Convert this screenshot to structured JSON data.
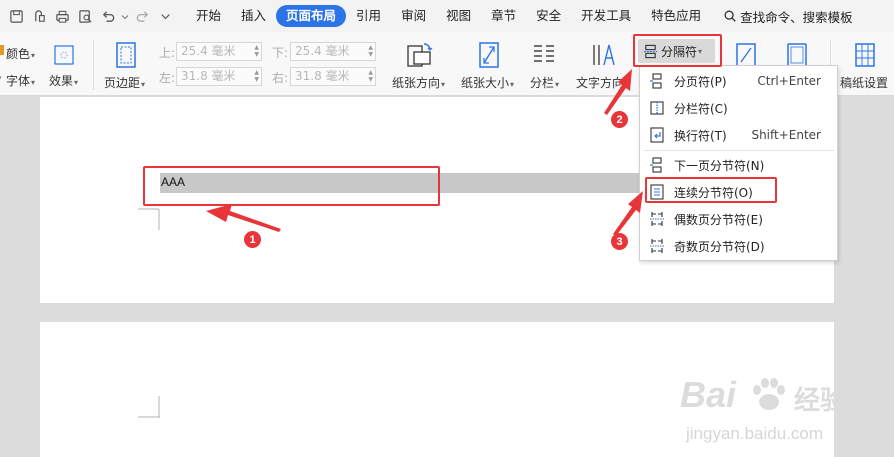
{
  "menu": {
    "tabs": [
      {
        "label": "开始",
        "active": false
      },
      {
        "label": "插入",
        "active": false
      },
      {
        "label": "页面布局",
        "active": true
      },
      {
        "label": "引用",
        "active": false
      },
      {
        "label": "审阅",
        "active": false
      },
      {
        "label": "视图",
        "active": false
      },
      {
        "label": "章节",
        "active": false
      },
      {
        "label": "安全",
        "active": false
      },
      {
        "label": "开发工具",
        "active": false
      },
      {
        "label": "特色应用",
        "active": false
      }
    ],
    "search_label": "查找命令、搜索模板"
  },
  "ribbon": {
    "color_label": "颜色",
    "font_label": "字体",
    "effect_label": "效果",
    "margin_label": "页边距",
    "top_label": "上:",
    "top_value": "25.4 毫米",
    "bottom_label": "下:",
    "bottom_value": "25.4 毫米",
    "left_label": "左:",
    "left_value": "31.8 毫米",
    "right_label": "右:",
    "right_value": "31.8 毫米",
    "orientation_label": "纸张方向",
    "size_label": "纸张大小",
    "columns_label": "分栏",
    "text_dir_label": "文字方向",
    "separator_label": "分隔符",
    "draft_label": "稿纸设置"
  },
  "document": {
    "text": "AAA"
  },
  "dropdown": {
    "items": [
      {
        "label": "分页符(P)",
        "shortcut": "Ctrl+Enter"
      },
      {
        "label": "分栏符(C)",
        "shortcut": ""
      },
      {
        "label": "换行符(T)",
        "shortcut": "Shift+Enter"
      },
      {
        "label": "下一页分节符(N)",
        "shortcut": ""
      },
      {
        "label": "连续分节符(O)",
        "shortcut": ""
      },
      {
        "label": "偶数页分节符(E)",
        "shortcut": ""
      },
      {
        "label": "奇数页分节符(D)",
        "shortcut": ""
      }
    ]
  },
  "annotations": {
    "step1": "1",
    "step2": "2",
    "step3": "3",
    "color": "#e8353a"
  },
  "watermark": {
    "brand": "Bai",
    "brand2": "经验",
    "url": "jingyan.baidu.com"
  },
  "colors": {
    "accent": "#2b73e6",
    "annotation": "#e8353a"
  }
}
